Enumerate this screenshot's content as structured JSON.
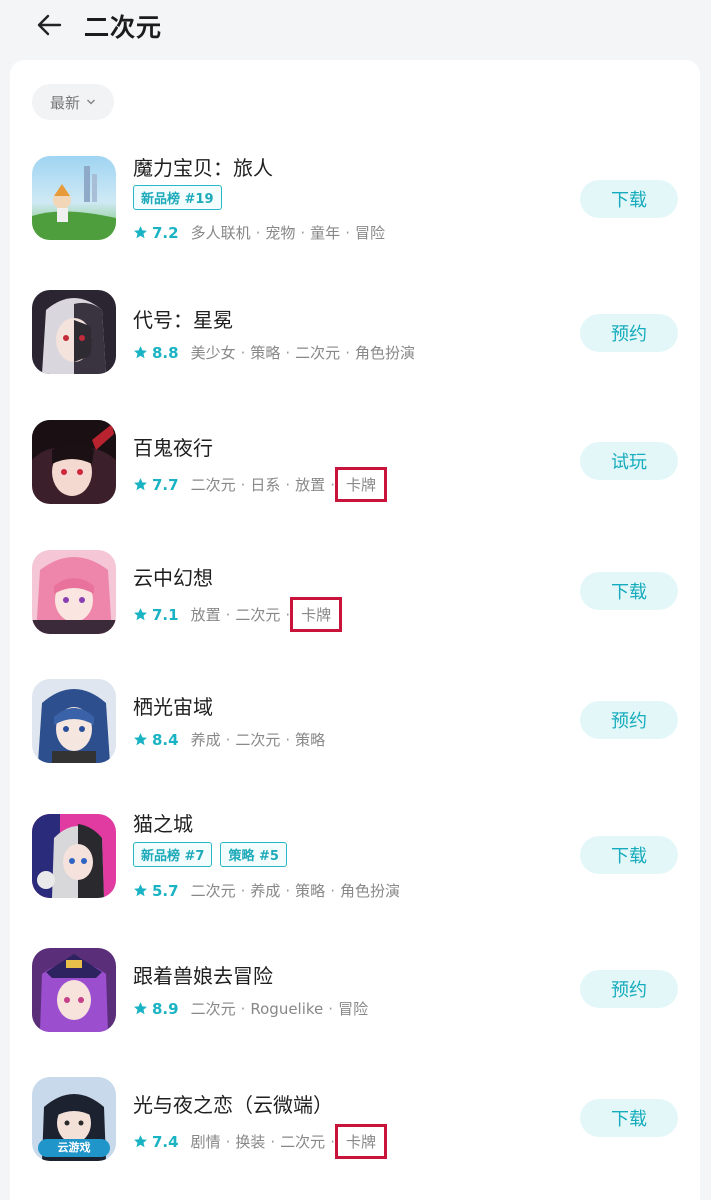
{
  "header": {
    "title": "二次元",
    "back_icon": "arrow-left-icon"
  },
  "sort": {
    "label": "最新",
    "icon": "chevron-down-icon"
  },
  "colors": {
    "accent": "#1ab3c4",
    "button_bg": "#e4f7f8",
    "highlight_box": "#c8143a"
  },
  "apps": [
    {
      "name": "魔力宝贝：旅人",
      "badges": [
        "新品榜 #19"
      ],
      "rating": "7.2",
      "tags": [
        "多人联机",
        "宠物",
        "童年",
        "冒险"
      ],
      "action": "下载"
    },
    {
      "name": "代号：星冕",
      "badges": [],
      "rating": "8.8",
      "tags": [
        "美少女",
        "策略",
        "二次元",
        "角色扮演"
      ],
      "action": "预约"
    },
    {
      "name": "百鬼夜行",
      "badges": [],
      "rating": "7.7",
      "tags": [
        "二次元",
        "日系",
        "放置",
        "卡牌"
      ],
      "action": "试玩"
    },
    {
      "name": "云中幻想",
      "badges": [],
      "rating": "7.1",
      "tags": [
        "放置",
        "二次元",
        "卡牌"
      ],
      "action": "下载"
    },
    {
      "name": "栖光宙域",
      "badges": [],
      "rating": "8.4",
      "tags": [
        "养成",
        "二次元",
        "策略"
      ],
      "action": "预约"
    },
    {
      "name": "猫之城",
      "badges": [
        "新品榜 #7",
        "策略 #5"
      ],
      "rating": "5.7",
      "tags": [
        "二次元",
        "养成",
        "策略",
        "角色扮演"
      ],
      "action": "下载"
    },
    {
      "name": "跟着兽娘去冒险",
      "badges": [],
      "rating": "8.9",
      "tags": [
        "二次元",
        "Roguelike",
        "冒险"
      ],
      "action": "预约"
    },
    {
      "name": "光与夜之恋（云微端）",
      "badges": [],
      "rating": "7.4",
      "tags": [
        "剧情",
        "换装",
        "二次元",
        "卡牌"
      ],
      "action": "下载",
      "icon_label": "云游戏"
    }
  ]
}
